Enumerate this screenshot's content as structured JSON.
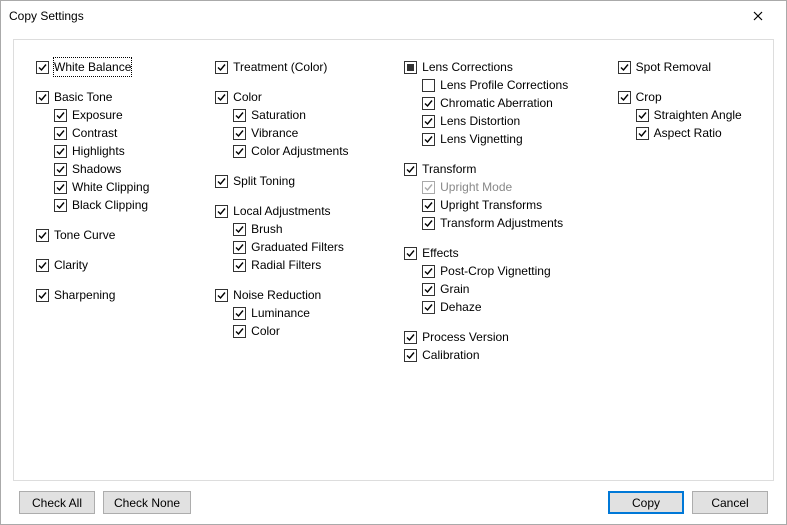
{
  "window": {
    "title": "Copy Settings"
  },
  "col1": {
    "whiteBalance": "White Balance",
    "basicTone": "Basic Tone",
    "exposure": "Exposure",
    "contrast": "Contrast",
    "highlights": "Highlights",
    "shadows": "Shadows",
    "whiteClipping": "White Clipping",
    "blackClipping": "Black Clipping",
    "toneCurve": "Tone Curve",
    "clarity": "Clarity",
    "sharpening": "Sharpening"
  },
  "col2": {
    "treatment": "Treatment (Color)",
    "color": "Color",
    "saturation": "Saturation",
    "vibrance": "Vibrance",
    "colorAdjustments": "Color Adjustments",
    "splitToning": "Split Toning",
    "localAdjustments": "Local Adjustments",
    "brush": "Brush",
    "graduatedFilters": "Graduated Filters",
    "radialFilters": "Radial Filters",
    "noiseReduction": "Noise Reduction",
    "luminance": "Luminance",
    "nrColor": "Color"
  },
  "col3": {
    "lensCorrections": "Lens Corrections",
    "lensProfile": "Lens Profile Corrections",
    "chromaticAberration": "Chromatic Aberration",
    "lensDistortion": "Lens Distortion",
    "lensVignetting": "Lens Vignetting",
    "transform": "Transform",
    "uprightMode": "Upright Mode",
    "uprightTransforms": "Upright Transforms",
    "transformAdjustments": "Transform Adjustments",
    "effects": "Effects",
    "postCropVignetting": "Post-Crop Vignetting",
    "grain": "Grain",
    "dehaze": "Dehaze",
    "processVersion": "Process Version",
    "calibration": "Calibration"
  },
  "col4": {
    "spotRemoval": "Spot Removal",
    "crop": "Crop",
    "straightenAngle": "Straighten Angle",
    "aspectRatio": "Aspect Ratio"
  },
  "buttons": {
    "checkAll": "Check All",
    "checkNone": "Check None",
    "copy": "Copy",
    "cancel": "Cancel"
  }
}
